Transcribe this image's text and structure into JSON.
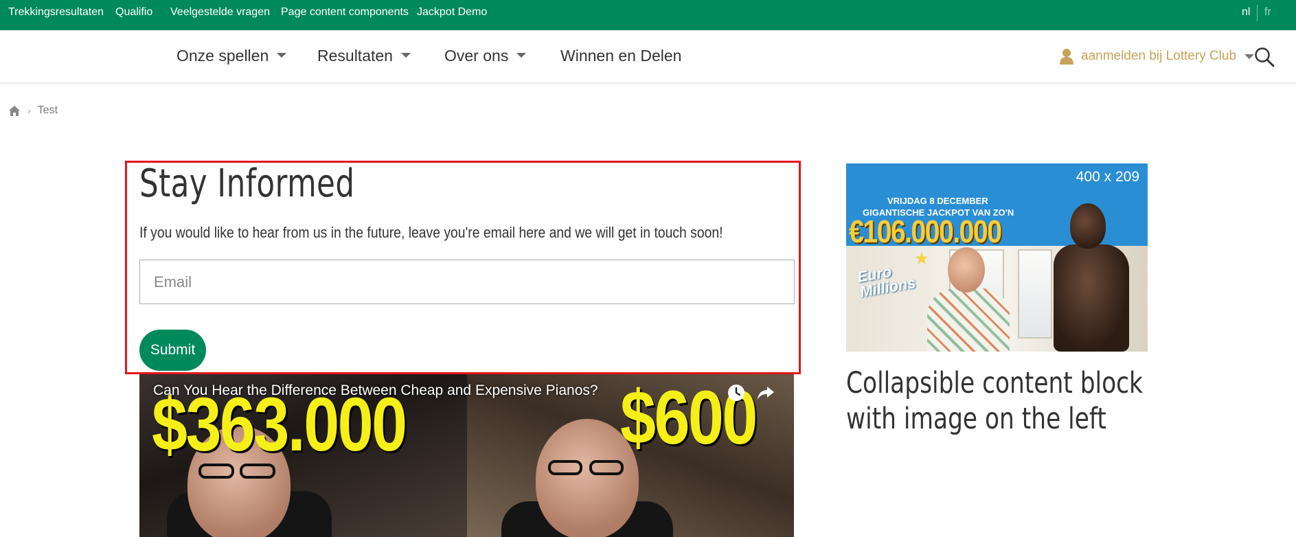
{
  "topbar": {
    "links": [
      "Trekkingsresultaten",
      "Qualifio",
      "Veelgestelde vragen",
      "Page content components",
      "Jackpot Demo"
    ],
    "lang_active": "nl",
    "lang_other": "fr",
    "background": "#00895b"
  },
  "mainnav": {
    "items": [
      "Onze spellen",
      "Resultaten",
      "Over ons",
      "Winnen en Delen"
    ],
    "login_label": "aanmelden bij Lottery Club",
    "login_color": "#c4a45a"
  },
  "breadcrumb": {
    "current": "Test"
  },
  "form": {
    "title": "Stay Informed",
    "description": "If you would like to hear from us in the future, leave you're email here and we will get in touch soon!",
    "email_placeholder": "Email",
    "email_value": "",
    "submit_label": "Submit",
    "highlight_color": "#e3151a"
  },
  "video": {
    "title": "Can You Hear the Difference Between Cheap and Expensive Pianos?",
    "price_left": "$363.000",
    "price_right": "$600",
    "icons": [
      "watch-later-icon",
      "share-icon"
    ]
  },
  "ad": {
    "size_label": "400 x 209",
    "line1": "VRIJDAG 8 DECEMBER",
    "line2": "GIGANTISCHE JACKPOT VAN ZO'N",
    "amount": "€106.000.000",
    "brand_line1": "Euro",
    "brand_line2": "Millions"
  },
  "sidebar": {
    "title_line1": "Collapsible content block",
    "title_line2": "with image on the left"
  }
}
